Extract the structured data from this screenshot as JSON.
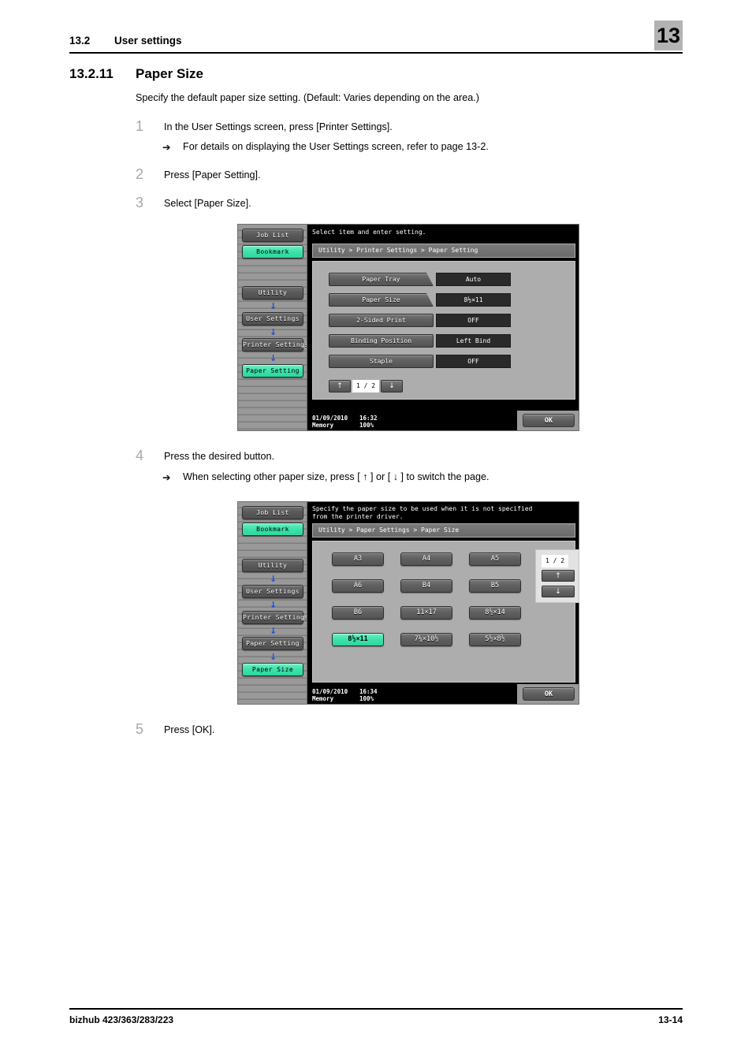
{
  "header": {
    "section_number": "13.2",
    "section_title": "User settings",
    "chapter_tab": "13"
  },
  "section": {
    "number": "13.2.11",
    "title": "Paper Size",
    "intro": "Specify the default paper size setting. (Default: Varies depending on the area.)"
  },
  "steps": [
    {
      "num": "1",
      "text": "In the User Settings screen, press [Printer Settings].",
      "sub": "For details on displaying the User Settings screen, refer to page 13-2."
    },
    {
      "num": "2",
      "text": "Press [Paper Setting]."
    },
    {
      "num": "3",
      "text": "Select [Paper Size]."
    },
    {
      "num": "4",
      "text": "Press the desired button.",
      "sub": "When selecting other paper size, press [ ↑ ] or [ ↓ ] to switch the page."
    },
    {
      "num": "5",
      "text": "Press [OK]."
    }
  ],
  "panel1": {
    "message": "Select item and enter setting.",
    "breadcrumb": "Utility > Printer Settings > Paper Setting",
    "sidebar": {
      "top_buttons": [
        {
          "label": "Job List",
          "state": "normal"
        },
        {
          "label": "Bookmark",
          "state": "selected"
        }
      ],
      "trail": [
        {
          "label": "Utility",
          "state": "normal"
        },
        {
          "label": "User Settings",
          "state": "normal"
        },
        {
          "label": "Printer Settings",
          "state": "normal"
        },
        {
          "label": "Paper Setting",
          "state": "selected"
        }
      ]
    },
    "rows": [
      {
        "label": "Paper Tray",
        "value": "Auto",
        "drill": true
      },
      {
        "label": "Paper Size",
        "value": "8½×11",
        "drill": true
      },
      {
        "label": "2-Sided Print",
        "value": "OFF",
        "drill": false
      },
      {
        "label": "Binding Position",
        "value": "Left Bind",
        "drill": false
      },
      {
        "label": "Staple",
        "value": "OFF",
        "drill": false
      }
    ],
    "pager": {
      "up": "↑",
      "count": "1 / 2",
      "down": "↓"
    },
    "status": {
      "date": "01/09/2010",
      "time": "16:32",
      "memory_label": "Memory",
      "memory_value": "100%"
    },
    "ok_label": "OK"
  },
  "panel2": {
    "message": "Specify the paper size to be used when it is not specified\nfrom the printer driver.",
    "breadcrumb": "Utility > Paper Settings > Paper Size",
    "sidebar": {
      "top_buttons": [
        {
          "label": "Job List",
          "state": "normal"
        },
        {
          "label": "Bookmark",
          "state": "selected"
        }
      ],
      "trail": [
        {
          "label": "Utility",
          "state": "normal"
        },
        {
          "label": "User Settings",
          "state": "normal"
        },
        {
          "label": "Printer Settings",
          "state": "normal"
        },
        {
          "label": "Paper Setting",
          "state": "normal"
        },
        {
          "label": "Paper Size",
          "state": "selected"
        }
      ]
    },
    "sizes": [
      {
        "label": "A3",
        "selected": false
      },
      {
        "label": "A4",
        "selected": false
      },
      {
        "label": "A5",
        "selected": false
      },
      {
        "label": "A6",
        "selected": false
      },
      {
        "label": "B4",
        "selected": false
      },
      {
        "label": "B5",
        "selected": false
      },
      {
        "label": "B6",
        "selected": false
      },
      {
        "label": "11×17",
        "selected": false
      },
      {
        "label": "8½×14",
        "selected": false
      },
      {
        "label": "8½×11",
        "selected": true
      },
      {
        "label": "7¼×10½",
        "selected": false
      },
      {
        "label": "5½×8½",
        "selected": false
      }
    ],
    "pager": {
      "count": "1 / 2",
      "up": "↑",
      "down": "↓"
    },
    "status": {
      "date": "01/09/2010",
      "time": "16:34",
      "memory_label": "Memory",
      "memory_value": "100%"
    },
    "ok_label": "OK"
  },
  "footer": {
    "product": "bizhub 423/363/283/223",
    "page": "13-14"
  },
  "colors": {
    "accent_green": "#3FE3AB",
    "chapter_tab_bg": "#B3B3B3",
    "step_number": "#A8A8A8"
  }
}
